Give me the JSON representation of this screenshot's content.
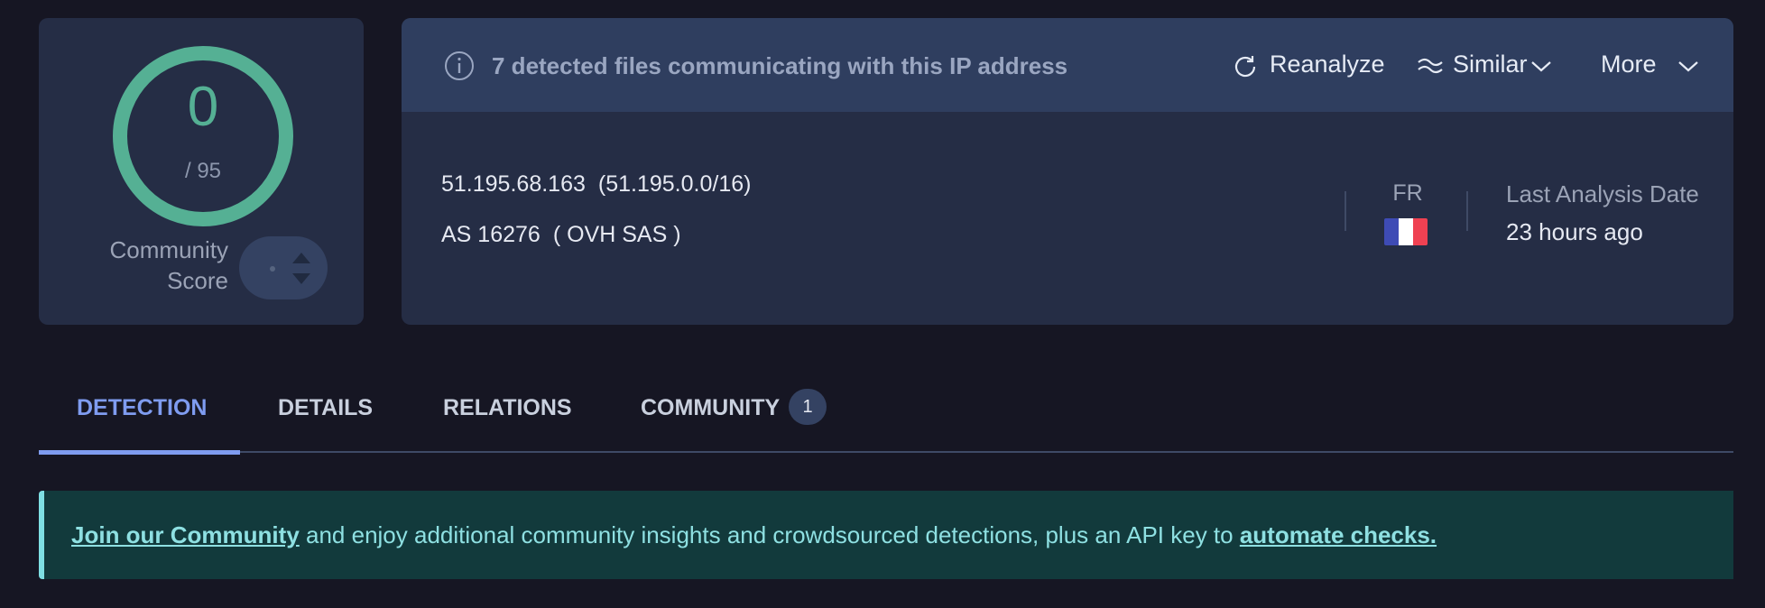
{
  "score": {
    "value": "0",
    "total": "/ 95",
    "community_label_line1": "Community",
    "community_label_line2": "Score",
    "ring_color": "#55b094"
  },
  "header": {
    "message": "7 detected files communicating with this IP address",
    "reanalyze_label": "Reanalyze",
    "similar_label": "Similar",
    "more_label": "More"
  },
  "ip_info": {
    "ip": "51.195.68.163",
    "cidr": "(51.195.0.0/16)",
    "as_number": "AS 16276",
    "as_owner": "( OVH SAS )",
    "country_code": "FR",
    "last_analysis_label": "Last Analysis Date",
    "last_analysis_value": "23 hours ago"
  },
  "tabs": [
    {
      "label": "DETECTION",
      "active": true
    },
    {
      "label": "DETAILS",
      "active": false
    },
    {
      "label": "RELATIONS",
      "active": false
    },
    {
      "label": "COMMUNITY",
      "active": false,
      "badge": "1"
    }
  ],
  "banner": {
    "link1": "Join our Community",
    "middle_text": " and enjoy additional community insights and crowdsourced detections, plus an API key to ",
    "link2": "automate checks."
  },
  "colors": {
    "background": "#161623",
    "card": "#252d45",
    "header": "#2f3e5f",
    "active_tab": "#7f9cf0",
    "banner_bg": "#123a3c",
    "banner_text": "#8ee0e2"
  }
}
